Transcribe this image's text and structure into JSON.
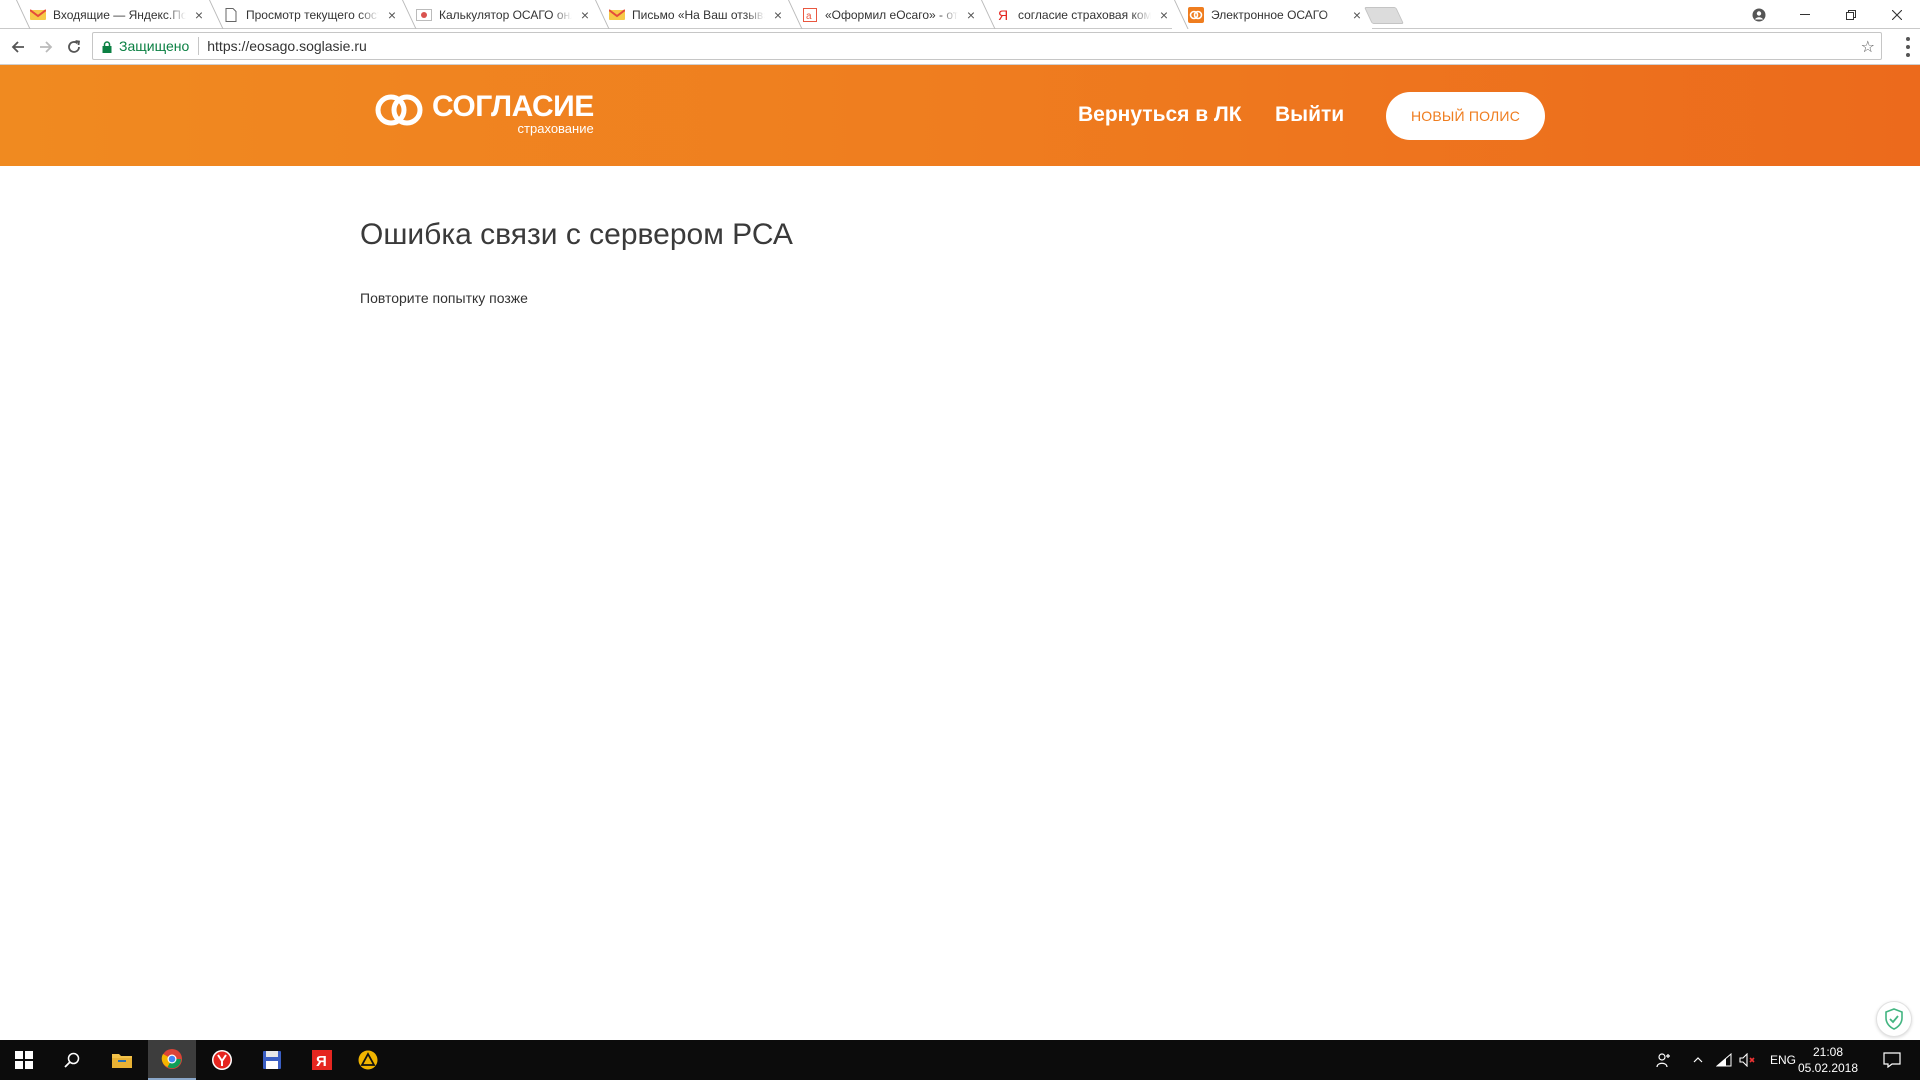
{
  "browser": {
    "tabs": [
      {
        "title": "Входящие — Яндекс.Почта",
        "icon": "yandex-mail-icon"
      },
      {
        "title": "Просмотр текущего состояния",
        "icon": "page-icon"
      },
      {
        "title": "Калькулятор ОСАГО онлайн",
        "icon": "calculator-icon"
      },
      {
        "title": "Письмо «На Ваш отзыв»",
        "icon": "yandex-mail-icon"
      },
      {
        "title": "«Оформил eОсаго» - отзыв",
        "icon": "irecommend-icon"
      },
      {
        "title": "согласие страховая компания",
        "icon": "yandex-icon"
      },
      {
        "title": "Электронное ОСАГО",
        "icon": "soglasie-icon",
        "active": true
      }
    ],
    "address": {
      "secure_label": "Защищено",
      "url": "https://eosago.soglasie.ru"
    }
  },
  "header": {
    "logo_brand": "СОГЛАСИЕ",
    "logo_sub": "страхование",
    "nav": {
      "back_to_account": "Вернуться в ЛК",
      "logout": "Выйти"
    },
    "new_policy_button": "НОВЫЙ ПОЛИС"
  },
  "main": {
    "title": "Ошибка связи с сервером РСА",
    "message": "Повторите попытку позже"
  },
  "taskbar": {
    "language": "ENG",
    "time": "21:08",
    "date": "05.02.2018"
  },
  "colors": {
    "header_start": "#f08a20",
    "header_end": "#ec6a1c",
    "accent": "#ef7d1f",
    "secure_green": "#0b8043"
  }
}
